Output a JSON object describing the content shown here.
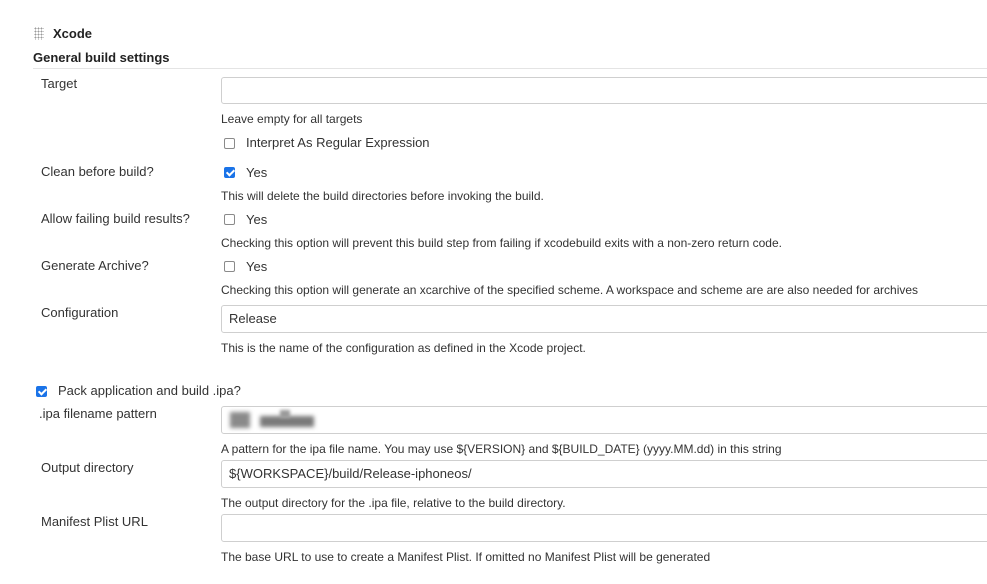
{
  "section": {
    "title": "Xcode"
  },
  "group": {
    "title": "General build settings"
  },
  "target": {
    "label": "Target",
    "value": "",
    "help": "Leave empty for all targets",
    "regex_checkbox": {
      "label": "Interpret As Regular Expression",
      "checked": false
    }
  },
  "clean": {
    "label": "Clean before build?",
    "checkbox": {
      "label": "Yes",
      "checked": true
    },
    "help": "This will delete the build directories before invoking the build."
  },
  "allow_failing": {
    "label": "Allow failing build results?",
    "checkbox": {
      "label": "Yes",
      "checked": false
    },
    "help": "Checking this option will prevent this build step from failing if xcodebuild exits with a non-zero return code."
  },
  "archive": {
    "label": "Generate Archive?",
    "checkbox": {
      "label": "Yes",
      "checked": false
    },
    "help": "Checking this option will generate an xcarchive of the specified scheme. A workspace and scheme are are also needed for archives"
  },
  "configuration": {
    "label": "Configuration",
    "value": "Release",
    "help": "This is the name of the configuration as defined in the Xcode project."
  },
  "pack": {
    "label": "Pack application and build .ipa?",
    "checked": true
  },
  "ipa_pattern": {
    "label": ".ipa filename pattern",
    "help": "A pattern for the ipa file name. You may use ${VERSION} and ${BUILD_DATE} (yyyy.MM.dd) in this string"
  },
  "output_dir": {
    "label": "Output directory",
    "value": "${WORKSPACE}/build/Release-iphoneos/",
    "help": "The output directory for the .ipa file, relative to the build directory."
  },
  "manifest": {
    "label": "Manifest Plist URL",
    "value": "",
    "help": "The base URL to use to create a Manifest Plist. If omitted no Manifest Plist will be generated"
  },
  "colors": {
    "accent": "#1a73e8",
    "border": "#cfcfcf",
    "text": "#333333"
  },
  "icons": {
    "section_handle": "drag-handle-icon",
    "checkbox_checked": "checkmark-icon"
  }
}
